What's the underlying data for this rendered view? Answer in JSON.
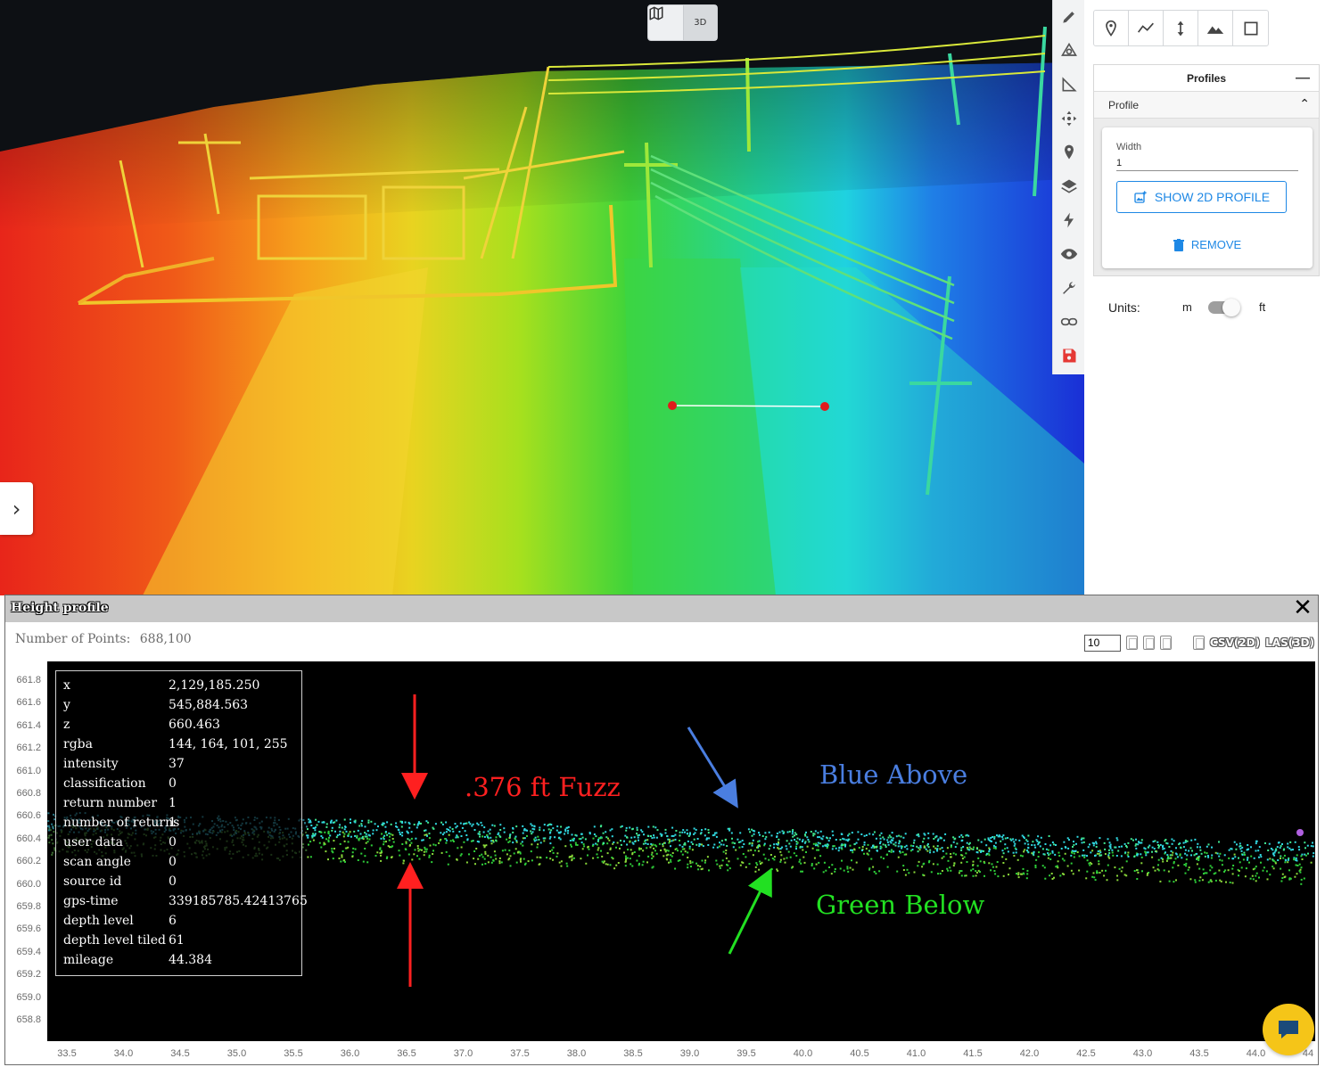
{
  "viewport": {
    "view_toggle": {
      "map_icon": "map-icon",
      "three_d_label": "3D"
    },
    "expand_icon": "›"
  },
  "toolbar": {
    "tools": [
      {
        "icon": "pencil-icon"
      },
      {
        "icon": "cloud-compare-icon"
      },
      {
        "icon": "angle-ruler-icon"
      },
      {
        "icon": "move-arrows-icon"
      },
      {
        "icon": "map-pin-icon"
      },
      {
        "icon": "layers-icon"
      },
      {
        "icon": "lightning-icon"
      },
      {
        "icon": "eye-icon"
      },
      {
        "icon": "wrench-icon"
      },
      {
        "icon": "link-icon"
      },
      {
        "icon": "save-icon"
      }
    ]
  },
  "measure_tools": [
    "point-icon",
    "polyline-icon",
    "height-icon",
    "profile-mountain-icon",
    "area-icon"
  ],
  "profiles": {
    "title": "Profiles",
    "collapse": "—",
    "profile_label": "Profile",
    "width_label": "Width",
    "width_value": "1",
    "show_button": "SHOW 2D PROFILE",
    "remove_button": "REMOVE"
  },
  "units": {
    "label": "Units:",
    "metric": "m",
    "imperial": "ft",
    "selected": "ft"
  },
  "height_profile": {
    "title": "Height profile",
    "close": "✕",
    "points_label": "Number of Points:",
    "points_value": "688,100",
    "point_budget": "10",
    "export_csv": "CSV(2D)",
    "export_las": "LAS(3D)",
    "y_ticks": [
      "661.8",
      "661.6",
      "661.4",
      "661.2",
      "661.0",
      "660.8",
      "660.6",
      "660.4",
      "660.2",
      "660.0",
      "659.8",
      "659.6",
      "659.4",
      "659.2",
      "659.0",
      "658.8"
    ],
    "x_ticks": [
      "33.5",
      "34.0",
      "34.5",
      "35.0",
      "35.5",
      "36.0",
      "36.5",
      "37.0",
      "37.5",
      "38.0",
      "38.5",
      "39.0",
      "39.5",
      "40.0",
      "40.5",
      "41.0",
      "41.5",
      "42.0",
      "42.5",
      "43.0",
      "43.5",
      "44.0",
      "44"
    ],
    "point_info": [
      {
        "key": "x",
        "value": "2,129,185.250"
      },
      {
        "key": "y",
        "value": "545,884.563"
      },
      {
        "key": "z",
        "value": "660.463"
      },
      {
        "key": "rgba",
        "value": "144, 164, 101, 255"
      },
      {
        "key": "intensity",
        "value": "37"
      },
      {
        "key": "classification",
        "value": "0"
      },
      {
        "key": "return number",
        "value": "1"
      },
      {
        "key": "number of returns",
        "value": "1"
      },
      {
        "key": "user data",
        "value": "0"
      },
      {
        "key": "scan angle",
        "value": "0"
      },
      {
        "key": "source id",
        "value": "0"
      },
      {
        "key": "gps-time",
        "value": "339185785.42413765"
      },
      {
        "key": "depth level",
        "value": "6"
      },
      {
        "key": "depth level tiled",
        "value": "61"
      },
      {
        "key": "mileage",
        "value": "44.384"
      }
    ],
    "annotations": {
      "fuzz": ".376 ft Fuzz",
      "blue": "Blue Above",
      "green": "Green Below"
    }
  },
  "colors": {
    "accent": "#1e88e5",
    "fuzz": "#ff2020",
    "blue_above": "#4a7ee0",
    "green_below": "#22e022",
    "save_icon": "#e53935"
  }
}
